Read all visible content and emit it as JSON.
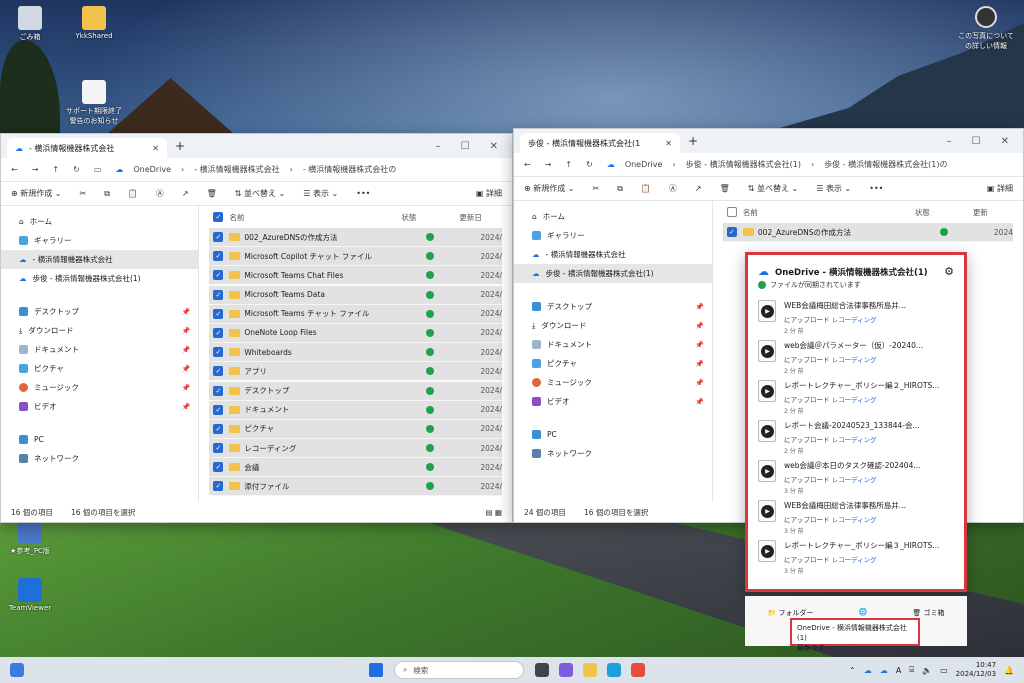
{
  "desktop": {
    "icons": [
      {
        "label": "ごみ箱",
        "name": "recycle-bin-icon"
      },
      {
        "label": "YkkShared",
        "name": "folder-icon"
      },
      {
        "label": "サポート期限終了警告のお知らせ",
        "name": "notice-file-icon"
      },
      {
        "label": "★参考_PC版",
        "name": "shortcut-icon"
      },
      {
        "label": "TeamViewer",
        "name": "teamviewer-icon"
      }
    ],
    "photo_info": "この写真についての詳しい情報"
  },
  "window_left": {
    "tab_title": "- 横浜情報機器株式会社",
    "address": [
      "OneDrive",
      "- 横浜情報機器株式会社",
      "- 横浜情報機器株式会社の"
    ],
    "toolbar": {
      "new": "新規作成",
      "sort": "並べ替え",
      "view": "表示",
      "more": "•••",
      "details": "詳細"
    },
    "nav": [
      {
        "label": "ホーム"
      },
      {
        "label": "ギャラリー"
      },
      {
        "label": "- 横浜情報機器株式会社",
        "selected": true
      },
      {
        "label": "歩俊 - 横浜情報機器株式会社(1)"
      },
      {
        "label": "デスクトップ"
      },
      {
        "label": "ダウンロード"
      },
      {
        "label": "ドキュメント"
      },
      {
        "label": "ピクチャ"
      },
      {
        "label": "ミュージック"
      },
      {
        "label": "ビデオ"
      },
      {
        "label": "PC"
      },
      {
        "label": "ネットワーク"
      }
    ],
    "headers": {
      "name": "名前",
      "status": "状態",
      "date": "更新日"
    },
    "files": [
      {
        "name": "002_AzureDNSの作成方法",
        "date": "2024/"
      },
      {
        "name": "Microsoft Copilot チャット ファイル",
        "date": "2024/"
      },
      {
        "name": "Microsoft Teams Chat Files",
        "date": "2024/"
      },
      {
        "name": "Microsoft Teams Data",
        "date": "2024/"
      },
      {
        "name": "Microsoft Teams チャット ファイル",
        "date": "2024/"
      },
      {
        "name": "OneNote Loop Files",
        "date": "2024/"
      },
      {
        "name": "Whiteboards",
        "date": "2024/"
      },
      {
        "name": "アプリ",
        "date": "2024/"
      },
      {
        "name": "デスクトップ",
        "date": "2024/"
      },
      {
        "name": "ドキュメント",
        "date": "2024/"
      },
      {
        "name": "ピクチャ",
        "date": "2024/"
      },
      {
        "name": "レコーディング",
        "date": "2024/"
      },
      {
        "name": "会議",
        "date": "2024/"
      },
      {
        "name": "添付ファイル",
        "date": "2024/"
      }
    ],
    "status": {
      "count": "16 個の項目",
      "selected": "16 個の項目を選択"
    }
  },
  "window_right": {
    "tab_title": "歩俊 - 横浜情報機器株式会社(1",
    "address": [
      "OneDrive",
      "歩俊 - 横浜情報機器株式会社(1)",
      "歩俊 - 横浜情報機器株式会社(1)の"
    ],
    "toolbar": {
      "new": "新規作成",
      "sort": "並べ替え",
      "view": "表示",
      "more": "•••",
      "details": "詳細"
    },
    "nav": [
      {
        "label": "ホーム"
      },
      {
        "label": "ギャラリー"
      },
      {
        "label": "- 横浜情報機器株式会社"
      },
      {
        "label": "歩俊 - 横浜情報機器株式会社(1)",
        "selected": true
      },
      {
        "label": "デスクトップ"
      },
      {
        "label": "ダウンロード"
      },
      {
        "label": "ドキュメント"
      },
      {
        "label": "ピクチャ"
      },
      {
        "label": "ミュージック"
      },
      {
        "label": "ビデオ"
      },
      {
        "label": "PC"
      },
      {
        "label": "ネットワーク"
      }
    ],
    "headers": {
      "name": "名前",
      "status": "状態",
      "date": "更新"
    },
    "first_file": {
      "name": "002_AzureDNSの作成方法",
      "date": "2024"
    },
    "status": {
      "count": "24 個の項目",
      "selected": "16 個の項目を選択"
    }
  },
  "onedrive": {
    "title": "OneDrive - 横浜情報機器株式会社(1)",
    "sync_status": "ファイルが同期されています",
    "items": [
      {
        "title": "WEB会議梅田総合法律事務所島井...",
        "status": "にアップロード",
        "place": "レコーディング",
        "ago": "2 分 前"
      },
      {
        "title": "web会議＠パラメーター（仮）-20240...",
        "status": "にアップロード",
        "place": "レコーディング",
        "ago": "2 分 前"
      },
      {
        "title": "レポートレクチャー_ポリシー編２_HIROTS...",
        "status": "にアップロード",
        "place": "レコーディング",
        "ago": "2 分 前"
      },
      {
        "title": "レポート会議-20240523_133844-会...",
        "status": "にアップロード",
        "place": "レコーディング",
        "ago": "2 分 前"
      },
      {
        "title": "web会議＠本日のタスク確認-202404...",
        "status": "にアップロード",
        "place": "レコーディング",
        "ago": "3 分 前"
      },
      {
        "title": "WEB会議梅田総合法律事務所島井...",
        "status": "にアップロード",
        "place": "レコーディング",
        "ago": "3 分 前"
      },
      {
        "title": "レポートレクチャー_ポリシー編３_HIROTS...",
        "status": "にアップロード",
        "place": "レコーディング",
        "ago": "3 分 前"
      }
    ],
    "footer": {
      "folder": "フォルダー",
      "trash": "ゴミ箱"
    },
    "tooltip": {
      "line1": "OneDrive - 横浜情報機器株式会社(1)",
      "line2": "最新です"
    }
  },
  "taskbar": {
    "search": "検索",
    "time": "10:47",
    "date": "2024/12/03",
    "ime": "A"
  }
}
